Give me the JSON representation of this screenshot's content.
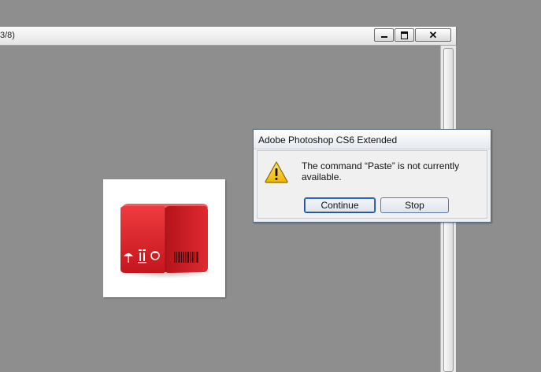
{
  "document_window": {
    "title_fragment": "3/8)",
    "close_symbol": "✕"
  },
  "canvas_image": {
    "description_icon": "red-box-package-icon"
  },
  "dialog": {
    "title": "Adobe Photoshop CS6 Extended",
    "icon": "warning-icon",
    "message": "The command “Paste” is not currently available.",
    "buttons": {
      "continue": "Continue",
      "stop": "Stop"
    }
  },
  "colors": {
    "canvas_background": "#8e8e8e",
    "box_red": "#d81e27",
    "warning_yellow": "#f6c81f"
  }
}
